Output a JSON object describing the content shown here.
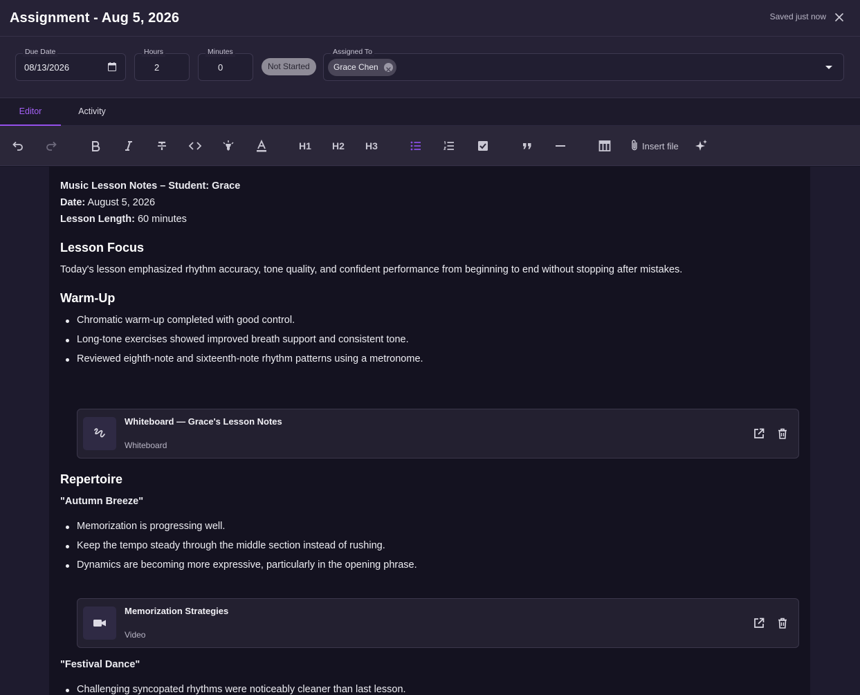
{
  "header": {
    "title": "Assignment - Aug 5, 2026",
    "saved_status": "Saved just now"
  },
  "fields": {
    "due_date": {
      "label": "Due Date",
      "value": "08/13/2026"
    },
    "hours": {
      "label": "Hours",
      "value": "2"
    },
    "minutes": {
      "label": "Minutes",
      "value": "0"
    },
    "status": "Not Started",
    "assigned_to": {
      "label": "Assigned To",
      "people": [
        "Grace Chen"
      ]
    }
  },
  "tabs": [
    {
      "label": "Editor",
      "active": true
    },
    {
      "label": "Activity",
      "active": false
    }
  ],
  "toolbar": {
    "h1": "H1",
    "h2": "H2",
    "h3": "H3",
    "insert_file": "Insert file",
    "icons": [
      "undo-icon",
      "redo-icon",
      "bold-icon",
      "italic-icon",
      "strikethrough-icon",
      "code-icon",
      "highlight-icon",
      "text-color-icon",
      "bullet-list-icon",
      "numbered-list-icon",
      "checklist-icon",
      "quote-icon",
      "horizontal-rule-icon",
      "table-icon",
      "paperclip-icon",
      "ai-sparkle-icon"
    ],
    "accent_color": "#8b4fe6"
  },
  "doc": {
    "title_line": "Music Lesson Notes – Student: Grace",
    "date_label": "Date:",
    "date_value": "August 5, 2026",
    "length_label": "Lesson Length:",
    "length_value": "60 minutes",
    "focus_heading": "Lesson Focus",
    "focus_text": "Today's lesson emphasized rhythm accuracy, tone quality, and confident performance from beginning to end without stopping after mistakes.",
    "warmup_heading": "Warm-Up",
    "warmup_items": [
      "Chromatic warm-up completed with good control.",
      "Long-tone exercises showed improved breath support and consistent tone.",
      "Reviewed eighth-note and sixteenth-note rhythm patterns using a metronome."
    ],
    "card1": {
      "title": "Whiteboard — Grace's Lesson Notes",
      "type": "Whiteboard"
    },
    "repertoire_heading": "Repertoire",
    "piece1_title": "\"Autumn Breeze\"",
    "piece1_items": [
      "Memorization is progressing well.",
      "Keep the tempo steady through the middle section instead of rushing.",
      "Dynamics are becoming more expressive, particularly in the opening phrase."
    ],
    "card2": {
      "title": "Memorization Strategies",
      "type": "Video"
    },
    "piece2_title": "\"Festival Dance\"",
    "piece2_items": [
      "Challenging syncopated rhythms were noticeably cleaner than last lesson."
    ]
  }
}
